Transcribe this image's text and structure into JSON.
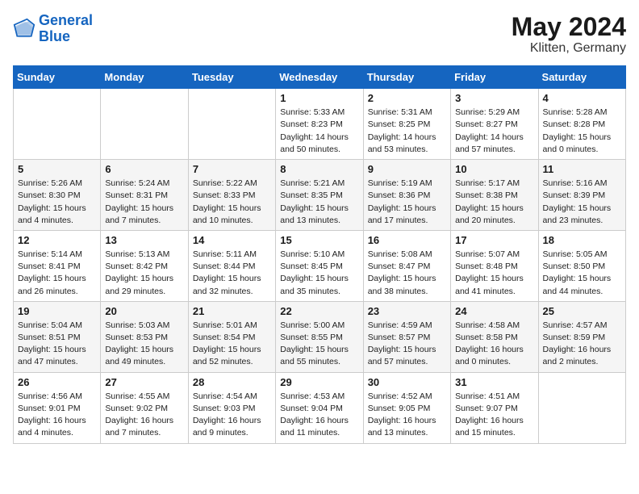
{
  "header": {
    "logo_line1": "General",
    "logo_line2": "Blue",
    "month": "May 2024",
    "location": "Klitten, Germany"
  },
  "days_of_week": [
    "Sunday",
    "Monday",
    "Tuesday",
    "Wednesday",
    "Thursday",
    "Friday",
    "Saturday"
  ],
  "weeks": [
    [
      {
        "day": "",
        "info": ""
      },
      {
        "day": "",
        "info": ""
      },
      {
        "day": "",
        "info": ""
      },
      {
        "day": "1",
        "info": "Sunrise: 5:33 AM\nSunset: 8:23 PM\nDaylight: 14 hours\nand 50 minutes."
      },
      {
        "day": "2",
        "info": "Sunrise: 5:31 AM\nSunset: 8:25 PM\nDaylight: 14 hours\nand 53 minutes."
      },
      {
        "day": "3",
        "info": "Sunrise: 5:29 AM\nSunset: 8:27 PM\nDaylight: 14 hours\nand 57 minutes."
      },
      {
        "day": "4",
        "info": "Sunrise: 5:28 AM\nSunset: 8:28 PM\nDaylight: 15 hours\nand 0 minutes."
      }
    ],
    [
      {
        "day": "5",
        "info": "Sunrise: 5:26 AM\nSunset: 8:30 PM\nDaylight: 15 hours\nand 4 minutes."
      },
      {
        "day": "6",
        "info": "Sunrise: 5:24 AM\nSunset: 8:31 PM\nDaylight: 15 hours\nand 7 minutes."
      },
      {
        "day": "7",
        "info": "Sunrise: 5:22 AM\nSunset: 8:33 PM\nDaylight: 15 hours\nand 10 minutes."
      },
      {
        "day": "8",
        "info": "Sunrise: 5:21 AM\nSunset: 8:35 PM\nDaylight: 15 hours\nand 13 minutes."
      },
      {
        "day": "9",
        "info": "Sunrise: 5:19 AM\nSunset: 8:36 PM\nDaylight: 15 hours\nand 17 minutes."
      },
      {
        "day": "10",
        "info": "Sunrise: 5:17 AM\nSunset: 8:38 PM\nDaylight: 15 hours\nand 20 minutes."
      },
      {
        "day": "11",
        "info": "Sunrise: 5:16 AM\nSunset: 8:39 PM\nDaylight: 15 hours\nand 23 minutes."
      }
    ],
    [
      {
        "day": "12",
        "info": "Sunrise: 5:14 AM\nSunset: 8:41 PM\nDaylight: 15 hours\nand 26 minutes."
      },
      {
        "day": "13",
        "info": "Sunrise: 5:13 AM\nSunset: 8:42 PM\nDaylight: 15 hours\nand 29 minutes."
      },
      {
        "day": "14",
        "info": "Sunrise: 5:11 AM\nSunset: 8:44 PM\nDaylight: 15 hours\nand 32 minutes."
      },
      {
        "day": "15",
        "info": "Sunrise: 5:10 AM\nSunset: 8:45 PM\nDaylight: 15 hours\nand 35 minutes."
      },
      {
        "day": "16",
        "info": "Sunrise: 5:08 AM\nSunset: 8:47 PM\nDaylight: 15 hours\nand 38 minutes."
      },
      {
        "day": "17",
        "info": "Sunrise: 5:07 AM\nSunset: 8:48 PM\nDaylight: 15 hours\nand 41 minutes."
      },
      {
        "day": "18",
        "info": "Sunrise: 5:05 AM\nSunset: 8:50 PM\nDaylight: 15 hours\nand 44 minutes."
      }
    ],
    [
      {
        "day": "19",
        "info": "Sunrise: 5:04 AM\nSunset: 8:51 PM\nDaylight: 15 hours\nand 47 minutes."
      },
      {
        "day": "20",
        "info": "Sunrise: 5:03 AM\nSunset: 8:53 PM\nDaylight: 15 hours\nand 49 minutes."
      },
      {
        "day": "21",
        "info": "Sunrise: 5:01 AM\nSunset: 8:54 PM\nDaylight: 15 hours\nand 52 minutes."
      },
      {
        "day": "22",
        "info": "Sunrise: 5:00 AM\nSunset: 8:55 PM\nDaylight: 15 hours\nand 55 minutes."
      },
      {
        "day": "23",
        "info": "Sunrise: 4:59 AM\nSunset: 8:57 PM\nDaylight: 15 hours\nand 57 minutes."
      },
      {
        "day": "24",
        "info": "Sunrise: 4:58 AM\nSunset: 8:58 PM\nDaylight: 16 hours\nand 0 minutes."
      },
      {
        "day": "25",
        "info": "Sunrise: 4:57 AM\nSunset: 8:59 PM\nDaylight: 16 hours\nand 2 minutes."
      }
    ],
    [
      {
        "day": "26",
        "info": "Sunrise: 4:56 AM\nSunset: 9:01 PM\nDaylight: 16 hours\nand 4 minutes."
      },
      {
        "day": "27",
        "info": "Sunrise: 4:55 AM\nSunset: 9:02 PM\nDaylight: 16 hours\nand 7 minutes."
      },
      {
        "day": "28",
        "info": "Sunrise: 4:54 AM\nSunset: 9:03 PM\nDaylight: 16 hours\nand 9 minutes."
      },
      {
        "day": "29",
        "info": "Sunrise: 4:53 AM\nSunset: 9:04 PM\nDaylight: 16 hours\nand 11 minutes."
      },
      {
        "day": "30",
        "info": "Sunrise: 4:52 AM\nSunset: 9:05 PM\nDaylight: 16 hours\nand 13 minutes."
      },
      {
        "day": "31",
        "info": "Sunrise: 4:51 AM\nSunset: 9:07 PM\nDaylight: 16 hours\nand 15 minutes."
      },
      {
        "day": "",
        "info": ""
      }
    ]
  ]
}
